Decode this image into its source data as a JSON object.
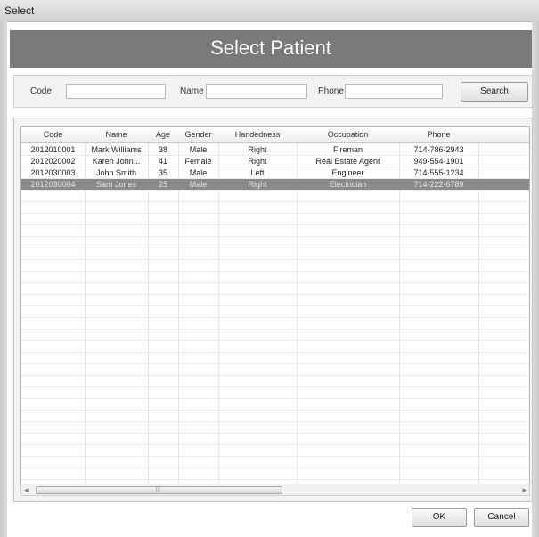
{
  "window": {
    "title": "Select"
  },
  "header": {
    "title": "Select Patient"
  },
  "filters": {
    "code_label": "Code",
    "code_value": "",
    "name_label": "Name",
    "name_value": "",
    "phone_label": "Phone",
    "phone_value": "",
    "search_label": "Search"
  },
  "table": {
    "columns": [
      "Code",
      "Name",
      "Age",
      "Gender",
      "Handedness",
      "Occupation",
      "Phone"
    ],
    "rows": [
      [
        "2012010001",
        "Mark Williams",
        "38",
        "Male",
        "Right",
        "Fireman",
        "714-786-2943"
      ],
      [
        "2012020002",
        "Karen John...",
        "41",
        "Female",
        "Right",
        "Real Estate Agent",
        "949-554-1901"
      ],
      [
        "2012030003",
        "John Smith",
        "35",
        "Male",
        "Left",
        "Engineer",
        "714-555-1234"
      ],
      [
        "2012030004",
        "Sam Jones",
        "25",
        "Male",
        "Right",
        "Electrician",
        "714-222-6789"
      ]
    ],
    "selected_row": 3
  },
  "scrollbar": {
    "left_arrow": "◂",
    "right_arrow": "▸",
    "grip": "|||"
  },
  "footer": {
    "ok_label": "OK",
    "cancel_label": "Cancel"
  }
}
